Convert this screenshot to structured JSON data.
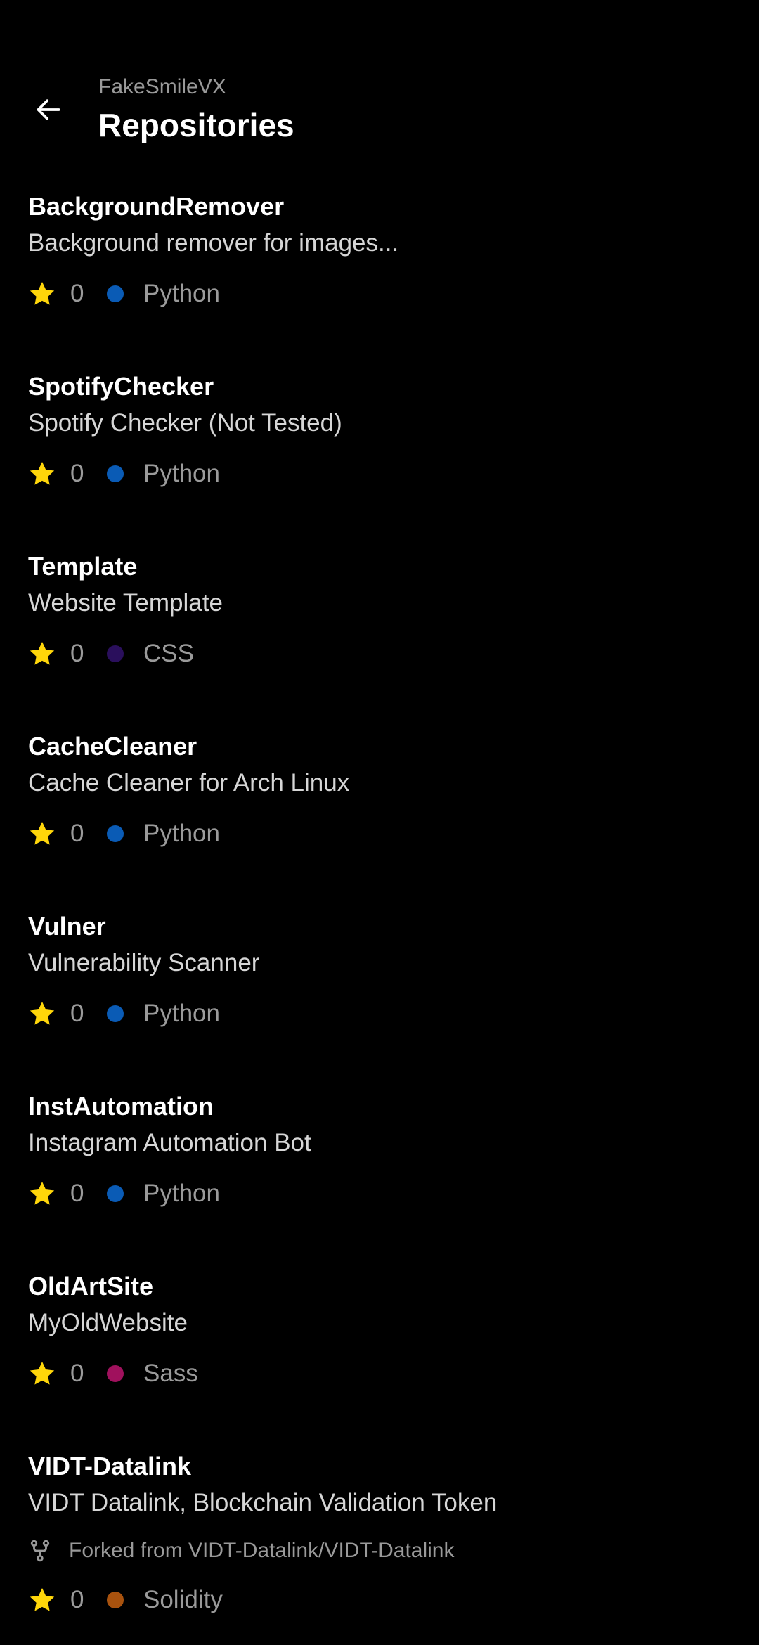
{
  "header": {
    "owner": "FakeSmileVX",
    "title": "Repositories",
    "back_icon": "arrow-left-icon"
  },
  "repositories": [
    {
      "name": "BackgroundRemover",
      "description": "Background remover for images...",
      "stars": "0",
      "language": "Python",
      "language_color": "#0a5bb5"
    },
    {
      "name": "SpotifyChecker",
      "description": "Spotify Checker (Not Tested)",
      "stars": "0",
      "language": "Python",
      "language_color": "#0a5bb5"
    },
    {
      "name": "Template",
      "description": "Website Template",
      "stars": "0",
      "language": "CSS",
      "language_color": "#2a0f5c"
    },
    {
      "name": "CacheCleaner",
      "description": "Cache Cleaner for Arch Linux",
      "stars": "0",
      "language": "Python",
      "language_color": "#0a5bb5"
    },
    {
      "name": "Vulner",
      "description": "Vulnerability Scanner",
      "stars": "0",
      "language": "Python",
      "language_color": "#0a5bb5"
    },
    {
      "name": "InstAutomation",
      "description": "Instagram Automation Bot",
      "stars": "0",
      "language": "Python",
      "language_color": "#0a5bb5"
    },
    {
      "name": "OldArtSite",
      "description": "MyOldWebsite",
      "stars": "0",
      "language": "Sass",
      "language_color": "#a0115d"
    },
    {
      "name": "VIDT-Datalink",
      "description": "VIDT Datalink, Blockchain Validation Token",
      "forked_from": "Forked from VIDT-Datalink/VIDT-Datalink",
      "stars": "0",
      "language": "Solidity",
      "language_color": "#a8520e"
    }
  ],
  "colors": {
    "background": "#000000",
    "star": "#ffd60a",
    "secondary_text": "#9a9a9a"
  }
}
